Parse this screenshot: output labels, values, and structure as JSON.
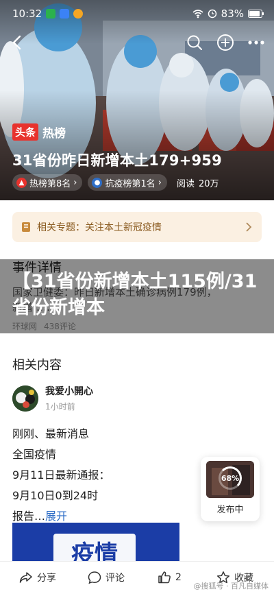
{
  "status_bar": {
    "time": "10:32",
    "battery": "83%"
  },
  "hero": {
    "brand_tag": "头条",
    "brand_title": "热榜",
    "title": "31省份昨日新增本土179+959",
    "chip_hot": "热榜第8名",
    "chip_epidemic": "抗疫榜第1名",
    "read_label": "阅读",
    "read_count": "20万"
  },
  "topic": {
    "label": "相关专题：关注本土新冠疫情"
  },
  "event": {
    "section_title": "事件详情",
    "line1": "国家卫健委：昨日新增本土确诊病例179例，",
    "line2": "新增……",
    "source": "环球网",
    "comments": "438评论"
  },
  "overlay": {
    "text": "【31省份新增本土115例/31省份新增本"
  },
  "related": {
    "section_title": "相关内容",
    "author_name": "我爱小開心",
    "author_time": "1小时前",
    "lines": [
      "刚刚、最新消息",
      "全国疫情",
      "9月11日最新通报：",
      "9月10日0到24时"
    ],
    "last_line_prefix": "报告…",
    "expand_label": "展开",
    "thumb_text": "疫情"
  },
  "floating": {
    "percent": "68%",
    "label": "发布中"
  },
  "bottom_bar": {
    "share": "分享",
    "comment": "评论",
    "like_count": "2",
    "favorite": "收藏"
  },
  "watermark": "@搜狐号 · 百凡自媒体",
  "colors": {
    "brand_red": "#e8322d",
    "link_blue": "#2e6ec7",
    "topic_bg": "#fbf0e2",
    "topic_text": "#8a5a1f"
  },
  "icons": [
    "back-arrow-icon",
    "search-icon",
    "add-icon",
    "fire-icon",
    "shield-icon",
    "document-icon",
    "chevron-right-icon",
    "share-icon",
    "comment-icon",
    "thumb-up-icon",
    "star-icon"
  ]
}
